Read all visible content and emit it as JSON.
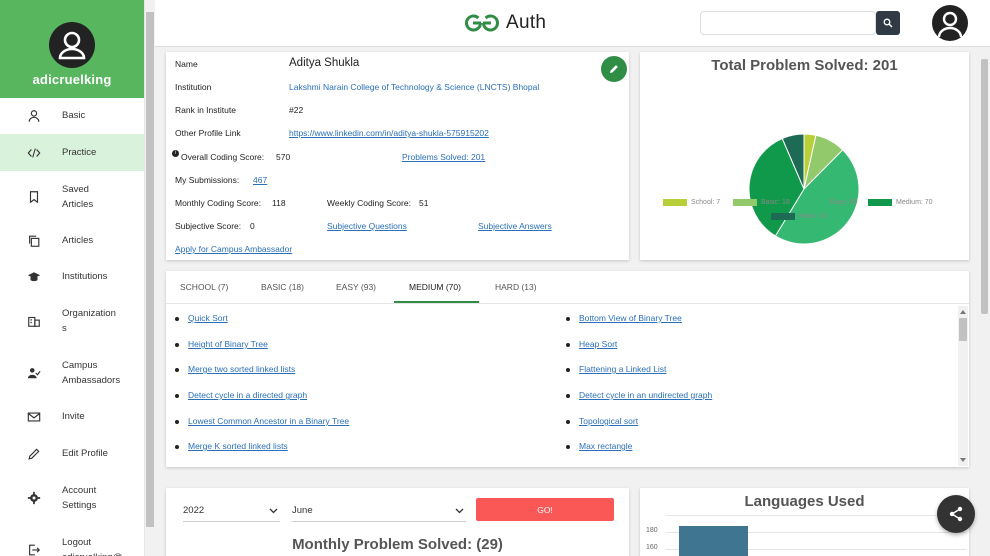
{
  "app": {
    "logo_text": "Auth"
  },
  "sidebar": {
    "username": "adicruelking",
    "items": [
      {
        "label_lines": [
          "Basic"
        ],
        "icon": "person-icon"
      },
      {
        "label_lines": [
          "Practice"
        ],
        "icon": "code-icon",
        "active": true
      },
      {
        "label_lines": [
          "Saved",
          "Articles"
        ],
        "icon": "bookmark-icon"
      },
      {
        "label_lines": [
          "Articles"
        ],
        "icon": "copy-icon"
      },
      {
        "label_lines": [
          "Institutions"
        ],
        "icon": "school-icon"
      },
      {
        "label_lines": [
          "Organization",
          "s"
        ],
        "icon": "building-icon"
      },
      {
        "label_lines": [
          "Campus",
          "Ambassadors"
        ],
        "icon": "person-check-icon"
      },
      {
        "label_lines": [
          "Invite"
        ],
        "icon": "mail-icon"
      },
      {
        "label_lines": [
          "Edit Profile"
        ],
        "icon": "pencil-icon"
      },
      {
        "label_lines": [
          "Account",
          "Settings"
        ],
        "icon": "gear-icon"
      },
      {
        "label_lines": [
          "Logout",
          "adicruelking@"
        ],
        "icon": "logout-icon"
      }
    ]
  },
  "profile": {
    "name_label": "Name",
    "name": "Aditya Shukla",
    "institution_label": "Institution",
    "institution": "Lakshmi Narain College of Technology & Science (LNCTS) Bhopal",
    "rank_label": "Rank in Institute",
    "rank": "#22",
    "other_label": "Other Profile Link",
    "other_link": "https://www.linkedin.com/in/aditya-shukla-575915202",
    "overall_label": "Overall Coding Score:",
    "overall_value": "570",
    "problems_solved": "Problems Solved: 201",
    "submissions_label": "My Submissions:",
    "submissions_value": "467",
    "monthly_label": "Monthly Coding Score:",
    "monthly_value": "118",
    "weekly_label": "Weekly Coding Score:",
    "weekly_value": "51",
    "subjective_label": "Subjective Score:",
    "subjective_value": "0",
    "subjective_questions": "Subjective Questions",
    "subjective_answers": "Subjective Answers",
    "campus_link": "Apply for Campus Ambassador"
  },
  "chart_data": {
    "type": "pie",
    "title": "Total Problem Solved: 201",
    "categories": [
      "School",
      "Basic",
      "Easy",
      "Medium",
      "Hard"
    ],
    "values": [
      7,
      18,
      93,
      70,
      13
    ],
    "colors": [
      "#b8cf3a",
      "#92c96b",
      "#35b872",
      "#10994a",
      "#1d6a55"
    ],
    "legend_labels": [
      "School: 7",
      "Basic: 18",
      "Easy: 93",
      "Medium: 70",
      "Hard: 13"
    ],
    "legend": "bottom"
  },
  "tabs": {
    "items": [
      "SCHOOL (7)",
      "BASIC (18)",
      "EASY (93)",
      "MEDIUM (70)",
      "HARD (13)"
    ],
    "active_index": 3
  },
  "problems": {
    "left": [
      "Quick Sort",
      "Height of Binary Tree",
      "Merge two sorted linked lists",
      "Detect cycle in a directed graph",
      "Lowest Common Ancestor in a Binary Tree",
      "Merge K sorted linked lists"
    ],
    "right": [
      "Bottom View of Binary Tree",
      "Heap Sort",
      "Flattening a Linked List",
      "Detect cycle in an undirected graph",
      "Topological sort",
      "Max rectangle"
    ]
  },
  "monthly": {
    "year": "2022",
    "month": "June",
    "go_label": "GO!",
    "title": "Monthly Problem Solved: (29)"
  },
  "languages": {
    "title": "Languages Used",
    "ticks": [
      "180",
      "160"
    ],
    "bar_color": "#3f7590"
  }
}
